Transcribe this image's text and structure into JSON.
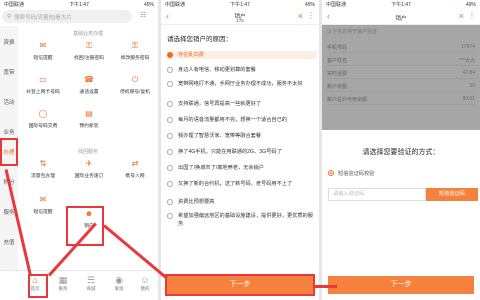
{
  "status": {
    "carrier": "中国联通",
    "network": "4G",
    "time": "下午1:47",
    "battery": "49%"
  },
  "panel1": {
    "search_placeholder": "搜索号码|流量包|看大片",
    "left_nav": [
      "资费",
      "宽带",
      "活动",
      "业务",
      "办理",
      "积分",
      "服务",
      "充值"
    ],
    "section1_title": "基础业务办理",
    "section2_title": "找回服务",
    "grid1": [
      {
        "label": "短信提醒",
        "icon": "message-icon"
      },
      {
        "label": "找回/注册密码",
        "icon": "key-icon"
      },
      {
        "label": "修改服务密码",
        "icon": "lock-icon"
      },
      {
        "label": "补登上网卡号码",
        "icon": "card-icon"
      },
      {
        "label": "通话设置",
        "icon": "phone-icon"
      },
      {
        "label": "停机保号/复机",
        "icon": "power-icon"
      },
      {
        "label": "国际号码交费",
        "icon": "globe-icon"
      },
      {
        "label": "预约新装",
        "icon": "calendar-icon"
      }
    ],
    "grid2": [
      {
        "label": "流量包办理",
        "icon": "data-icon"
      },
      {
        "label": "国际业务速订",
        "icon": "plane-icon"
      },
      {
        "label": "携号入网",
        "icon": "transfer-icon"
      },
      {
        "label": "短信提醒",
        "icon": "message-icon"
      },
      {
        "label": "销户",
        "icon": "user-icon"
      }
    ],
    "tabs": [
      {
        "label": "首页",
        "icon": "home-icon"
      },
      {
        "label": "服务",
        "icon": "grid-icon"
      },
      {
        "label": "商城",
        "icon": "cart-icon"
      },
      {
        "label": "发现",
        "icon": "compass-icon"
      },
      {
        "label": "我的",
        "icon": "person-icon"
      }
    ]
  },
  "panel2": {
    "title": "销户",
    "subtitle": "176",
    "question": "请选择您销户的原因：",
    "reasons": [
      "存在乱扣费",
      "身边人有电信、移动更划算的套餐",
      "宽带网络打不通，手网厅业务办理不成功，服务不太好",
      "支持联通，信号再提高一些就更好了",
      "每月的语音流量都用不完，想换一个适合自己的",
      "我办理了智慧沃家、宽带等融合套餐",
      "换了4G手机，只能在用联通的2G、3G号码了",
      "出国了/换城市了/离地养老，无余销户",
      "又换了新的合约机，送了新号码，老号码用不上了",
      "资费比预想要高",
      "希望加强偏远地区的基础设施建设，提供更好，更优质的服务"
    ],
    "next_label": "下一步"
  },
  "panel3": {
    "title": "销户",
    "header_note": "以下信息用于销户验证",
    "info": [
      {
        "k": "手机号码",
        "v": "17674"
      },
      {
        "k": "客户姓名",
        "v": "***大大"
      },
      {
        "k": "实时话费",
        "v": "47.84"
      },
      {
        "k": "账户余额",
        "v": "50"
      },
      {
        "k": "账户总计可用余额",
        "v": "99.01"
      }
    ],
    "dialog_title": "请选择您要验证的方式：",
    "option_label": "短信验证码校验",
    "code_placeholder": "请输入验证码",
    "code_button": "短信验证码",
    "next_label": "下一步"
  }
}
